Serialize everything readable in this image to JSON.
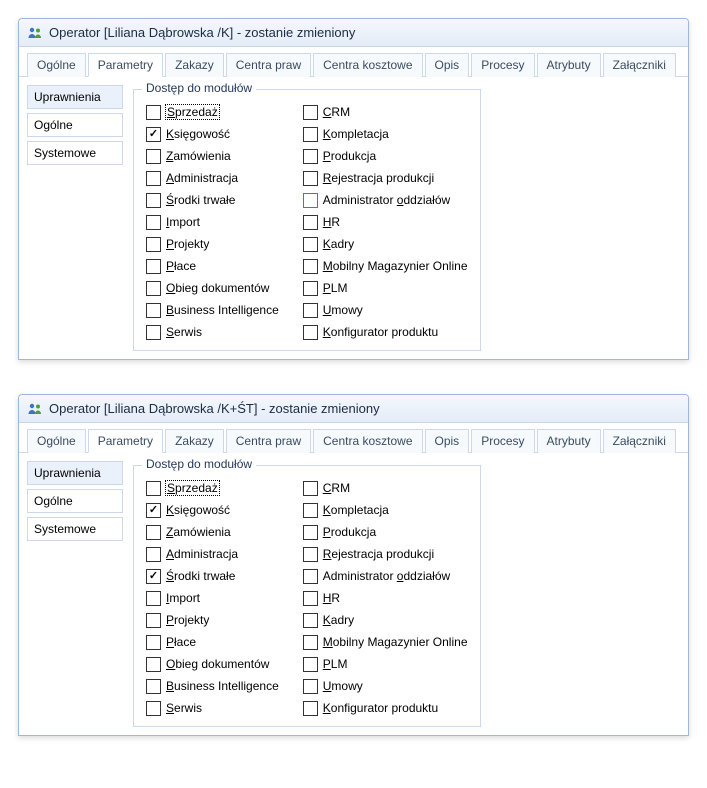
{
  "windows": [
    {
      "title": "Operator [Liliana Dąbrowska /K] - zostanie zmieniony",
      "tabs": [
        "Ogólne",
        "Parametry",
        "Zakazy",
        "Centra praw",
        "Centra kosztowe",
        "Opis",
        "Procesy",
        "Atrybuty",
        "Załączniki"
      ],
      "active_tab": 1,
      "sidebar": [
        "Uprawnienia",
        "Ogólne",
        "Systemowe"
      ],
      "active_sidebar": 0,
      "groupbox_title": "Dostęp do modułów",
      "left_col": [
        {
          "label": "Sprzedaż",
          "u": 0,
          "checked": false,
          "focus": true
        },
        {
          "label": "Księgowość",
          "u": 0,
          "checked": true
        },
        {
          "label": "Zamówienia",
          "u": 0,
          "checked": false
        },
        {
          "label": "Administracja",
          "u": 0,
          "checked": false
        },
        {
          "label": "Środki trwałe",
          "u": 0,
          "checked": false
        },
        {
          "label": "Import",
          "u": 0,
          "checked": false
        },
        {
          "label": "Projekty",
          "u": 0,
          "checked": false
        },
        {
          "label": "Płace",
          "u": 0,
          "checked": false
        },
        {
          "label": "Obieg dokumentów",
          "u": 0,
          "checked": false
        },
        {
          "label": "Business Intelligence",
          "u": 0,
          "checked": false
        },
        {
          "label": "Serwis",
          "u": 0,
          "checked": false
        }
      ],
      "right_col": [
        {
          "label": "CRM",
          "u": 0,
          "checked": false
        },
        {
          "label": "Kompletacja",
          "u": 0,
          "checked": false
        },
        {
          "label": "Produkcja",
          "u": 0,
          "checked": false
        },
        {
          "label": "Rejestracja produkcji",
          "u": 0,
          "checked": false
        },
        {
          "label": "Administrator oddziałów",
          "u": 14,
          "checked": false,
          "hl": true
        },
        {
          "label": "HR",
          "u": 0,
          "checked": false
        },
        {
          "label": "Kadry",
          "u": 0,
          "checked": false
        },
        {
          "label": "Mobilny Magazynier Online",
          "u": 0,
          "checked": false
        },
        {
          "label": "PLM",
          "u": 0,
          "checked": false
        },
        {
          "label": "Umowy",
          "u": 0,
          "checked": false
        },
        {
          "label": "Konfigurator produktu",
          "u": 0,
          "checked": false
        }
      ]
    },
    {
      "title": "Operator [Liliana Dąbrowska /K+ŚT] - zostanie zmieniony",
      "tabs": [
        "Ogólne",
        "Parametry",
        "Zakazy",
        "Centra praw",
        "Centra kosztowe",
        "Opis",
        "Procesy",
        "Atrybuty",
        "Załączniki"
      ],
      "active_tab": 1,
      "sidebar": [
        "Uprawnienia",
        "Ogólne",
        "Systemowe"
      ],
      "active_sidebar": 0,
      "groupbox_title": "Dostęp do modułów",
      "left_col": [
        {
          "label": "Sprzedaż",
          "u": 0,
          "checked": false,
          "focus": true
        },
        {
          "label": "Księgowość",
          "u": 0,
          "checked": true
        },
        {
          "label": "Zamówienia",
          "u": 0,
          "checked": false
        },
        {
          "label": "Administracja",
          "u": 0,
          "checked": false
        },
        {
          "label": "Środki trwałe",
          "u": 0,
          "checked": true
        },
        {
          "label": "Import",
          "u": 0,
          "checked": false
        },
        {
          "label": "Projekty",
          "u": 0,
          "checked": false
        },
        {
          "label": "Płace",
          "u": 0,
          "checked": false
        },
        {
          "label": "Obieg dokumentów",
          "u": 0,
          "checked": false
        },
        {
          "label": "Business Intelligence",
          "u": 0,
          "checked": false
        },
        {
          "label": "Serwis",
          "u": 0,
          "checked": false
        }
      ],
      "right_col": [
        {
          "label": "CRM",
          "u": 0,
          "checked": false
        },
        {
          "label": "Kompletacja",
          "u": 0,
          "checked": false
        },
        {
          "label": "Produkcja",
          "u": 0,
          "checked": false
        },
        {
          "label": "Rejestracja produkcji",
          "u": 0,
          "checked": false
        },
        {
          "label": "Administrator oddziałów",
          "u": 14,
          "checked": false
        },
        {
          "label": "HR",
          "u": 0,
          "checked": false
        },
        {
          "label": "Kadry",
          "u": 0,
          "checked": false
        },
        {
          "label": "Mobilny Magazynier Online",
          "u": 0,
          "checked": false
        },
        {
          "label": "PLM",
          "u": 0,
          "checked": false
        },
        {
          "label": "Umowy",
          "u": 0,
          "checked": false
        },
        {
          "label": "Konfigurator produktu",
          "u": 0,
          "checked": false
        }
      ]
    }
  ]
}
